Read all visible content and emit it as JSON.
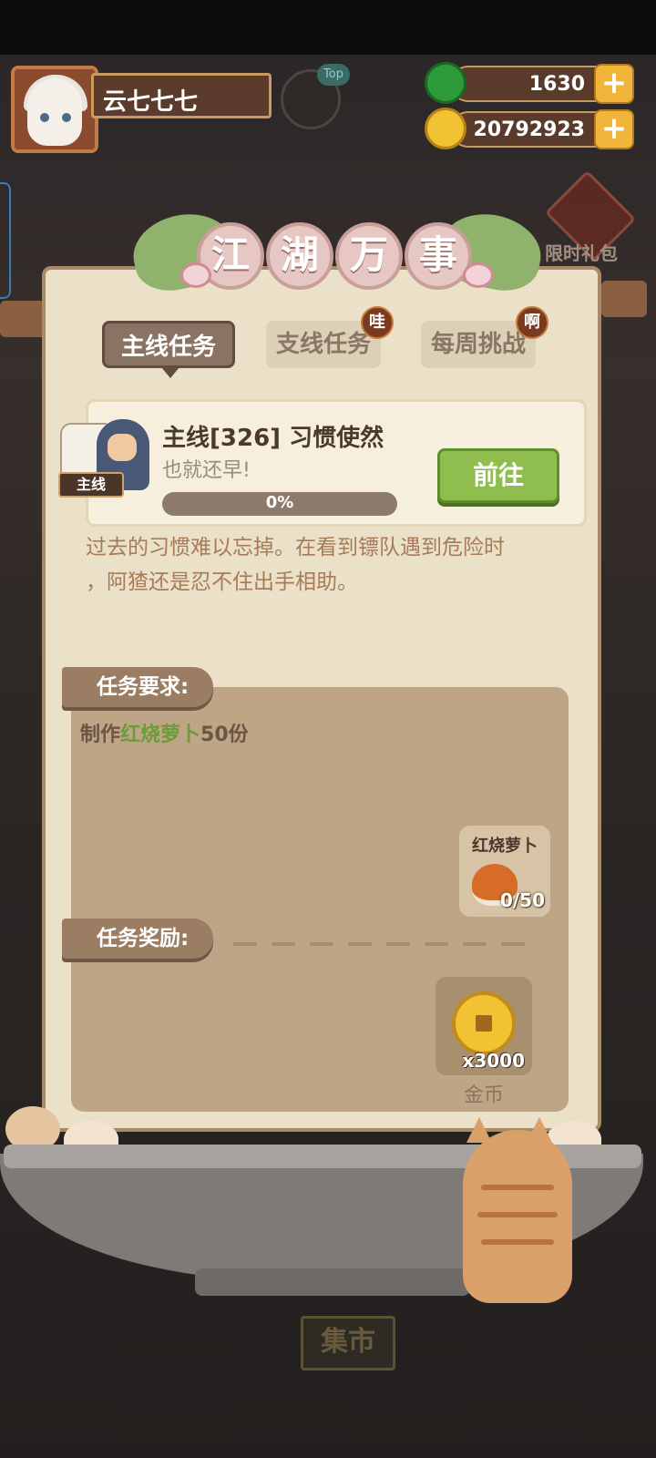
{
  "hud": {
    "player_name": "云七七七",
    "top_badge": "Top",
    "jade": "1630",
    "coins": "20792923",
    "gift_label": "限时礼包"
  },
  "panel": {
    "title_chars": [
      "江",
      "湖",
      "万",
      "事"
    ],
    "tabs": [
      {
        "label": "主线任务",
        "active": true,
        "badge": ""
      },
      {
        "label": "支线任务",
        "active": false,
        "badge": "哇"
      },
      {
        "label": "每周挑战",
        "active": false,
        "badge": "啊"
      }
    ]
  },
  "quest": {
    "tag": "主线",
    "title": "主线[326] 习惯使然",
    "subtitle": "也就还早!",
    "progress_text": "0%",
    "progress": 0,
    "go_label": "前往",
    "description_line1": "过去的习惯难以忘掉。在看到镖队遇到危险时",
    "description_line2": "，阿猹还是忍不住出手相助。"
  },
  "requirements": {
    "header": "任务要求:",
    "text_prefix": "制作",
    "text_item": "红烧萝卜",
    "text_suffix": "50份",
    "item_name": "红烧萝卜",
    "item_count": "0/50"
  },
  "rewards": {
    "header": "任务奖励:",
    "item_count": "x3000",
    "item_name": "金币"
  },
  "bottom": {
    "market_label": "集市"
  },
  "colors": {
    "accent_green": "#8fbe4f",
    "panel_bg": "#ebe0c8",
    "coin_gold": "#f1c232"
  }
}
